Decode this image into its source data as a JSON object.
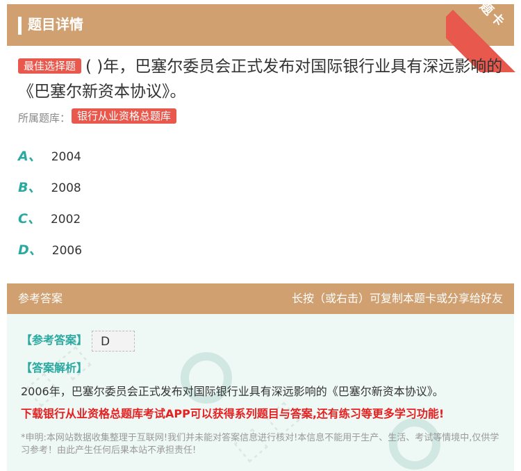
{
  "header": {
    "title": "题目详情",
    "ribbon": "题卡"
  },
  "question": {
    "type_tag": "最佳选择题",
    "text": "( )年，巴塞尔委员会正式发布对国际银行业具有深远影响的《巴塞尔新资本协议》。",
    "source_label": "所属题库：",
    "source_tag": "银行从业资格总题库"
  },
  "options": [
    {
      "letter": "A、",
      "text": "2004"
    },
    {
      "letter": "B、",
      "text": "2008"
    },
    {
      "letter": "C、",
      "text": "2002"
    },
    {
      "letter": "D、",
      "text": "2006"
    }
  ],
  "answer_section": {
    "title": "参考答案",
    "share_hint": "长按（或右击）可复制本题卡或分享给好友",
    "answer_label": "【参考答案】",
    "answer_value": "D",
    "analysis_label": "【答案解析】",
    "analysis_text": "2006年，巴塞尔委员会正式发布对国际银行业具有深远影响的《巴塞尔新资本协议》。",
    "promo": "下载银行从业资格总题库考试APP可以获得系列题目与答案,还有练习等更多学习功能!",
    "disclaimer": "*申明:本网站数据收集整理于互联网!我们并未能对答案信息进行核对!本信息不能用于生产、生活、考试等情境中,仅供学习参考！由此产生任何后果本站不承担责任!"
  },
  "colors": {
    "header_bg": "#d0a070",
    "tag_red": "#e8584c",
    "accent_teal": "#2aa9a0",
    "promo_red": "#e62020",
    "answer_bg": "#eef8f5"
  }
}
